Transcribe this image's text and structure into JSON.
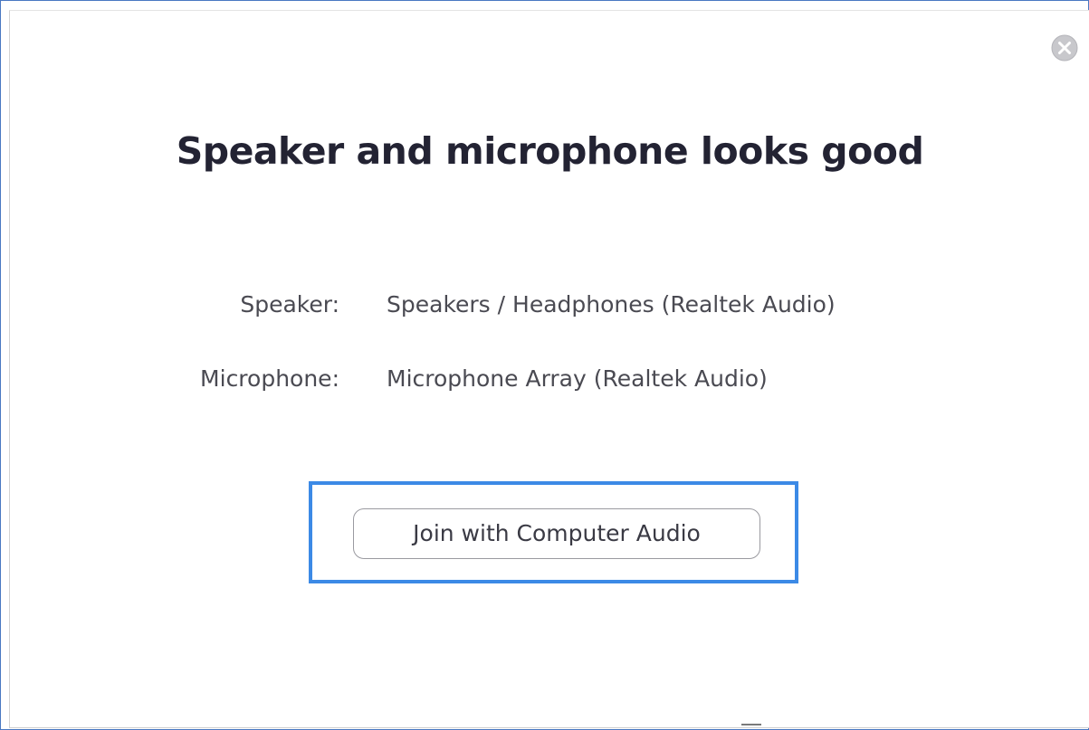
{
  "dialog": {
    "title": "Speaker and microphone looks good",
    "close_icon": "close-circle-icon",
    "speaker": {
      "label": "Speaker:",
      "value": "Speakers / Headphones (Realtek Audio)"
    },
    "microphone": {
      "label": "Microphone:",
      "value": "Microphone Array (Realtek Audio)"
    },
    "join_button_label": "Join with Computer Audio"
  },
  "colors": {
    "highlight_border": "#3c8ae6",
    "title_text": "#232333",
    "body_text": "#4a4a52",
    "button_border": "#9a9aa0"
  }
}
